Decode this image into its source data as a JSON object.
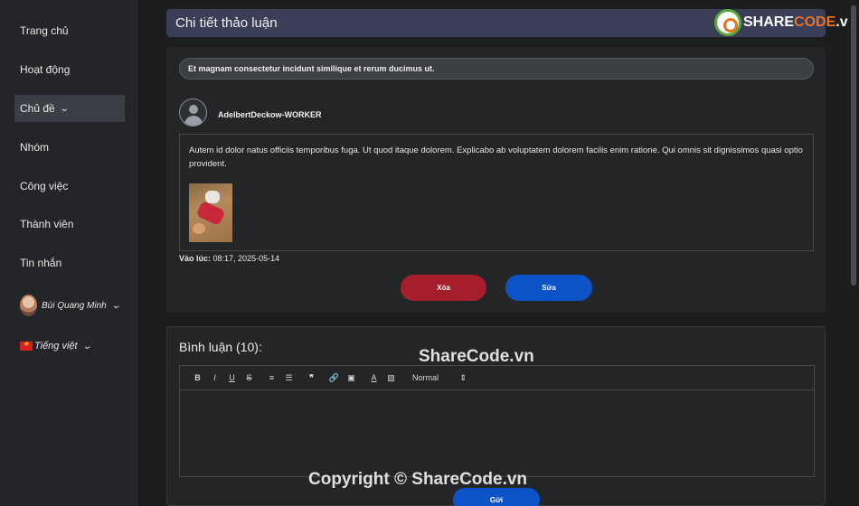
{
  "sidebar": {
    "items": [
      {
        "label": "Trang chủ"
      },
      {
        "label": "Hoạt động"
      },
      {
        "label": "Chủ đề"
      },
      {
        "label": "Nhóm"
      },
      {
        "label": "Công việc"
      },
      {
        "label": "Thành viên"
      },
      {
        "label": "Tin nhắn"
      }
    ],
    "user_name": "Bùi Quang Minh",
    "language": "Tiếng việt"
  },
  "header": {
    "title": "Chi tiết thảo luận",
    "logo_prefix": "SHARE",
    "logo_highlight": "CODE",
    "logo_suffix": ".vn"
  },
  "post": {
    "topic": "Et magnam consectetur incidunt similique et rerum ducimus ut.",
    "author": "AdelbertDeckow-WORKER",
    "content": "Autem id dolor natus officiis temporibus fuga. Ut quod itaque dolorem. Explicabo ab voluptatem dolorem facilis enim ratione. Qui omnis sit dignissimos quasi optio provident.",
    "time_label": "Vào lúc:",
    "time_value": "08:17, 2025-05-14",
    "delete_label": "Xóa",
    "edit_label": "Sửa"
  },
  "comments": {
    "title": "Bình luận (10):",
    "toolbar": {
      "bold": "B",
      "italic": "I",
      "underline": "U",
      "strike": "S",
      "ordered_list": "≡",
      "bullet_list": "☰",
      "quote": "❞",
      "link": "🔗",
      "image": "▣",
      "color": "A",
      "background": "▨",
      "size_value": "Normal",
      "size_arrow": "⇕"
    },
    "send_label": "Gửi"
  },
  "watermark": {
    "top": "ShareCode.vn",
    "bottom": "Copyright © ShareCode.vn"
  },
  "colors": {
    "header_bg": "#3a3e56",
    "delete_button": "#a61e2c",
    "primary_button": "#0b53c7"
  }
}
